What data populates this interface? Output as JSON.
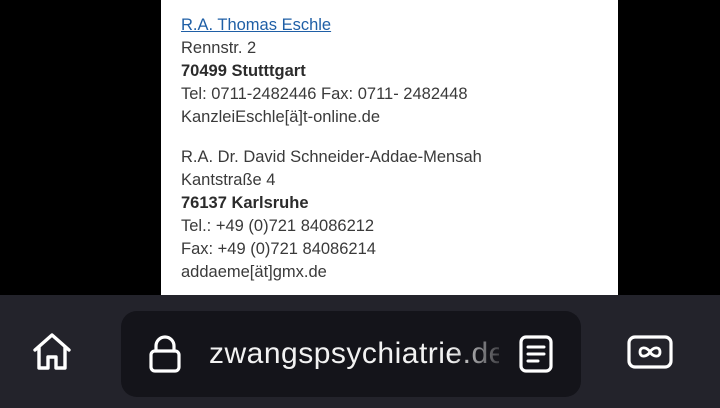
{
  "contacts": [
    {
      "name": "R.A. Thomas Eschle",
      "street": "Rennstr. 2",
      "city": "70499 Stutttgart",
      "phone": "Tel: 0711-2482446 Fax: 0711- 2482448",
      "email": "KanzleiEschle[ä]t-online.de"
    },
    {
      "name": "R.A. Dr. David Schneider-Addae-Mensah",
      "street": "Kantstraße 4",
      "city": "76137 Karlsruhe",
      "phone": "Tel.: +49 (0)721 84086212",
      "fax": "Fax: +49 (0)721 84086214",
      "email": "addaeme[ät]gmx.de"
    }
  ],
  "toolbar": {
    "url": "zwangspsychiatrie.de",
    "icons": [
      "home-icon",
      "lock-icon",
      "reader-mode-icon",
      "tabs-infinity-icon"
    ],
    "colors": {
      "bar": "#23232b",
      "urlbar": "#14141a",
      "link": "#1f5fa6"
    }
  }
}
